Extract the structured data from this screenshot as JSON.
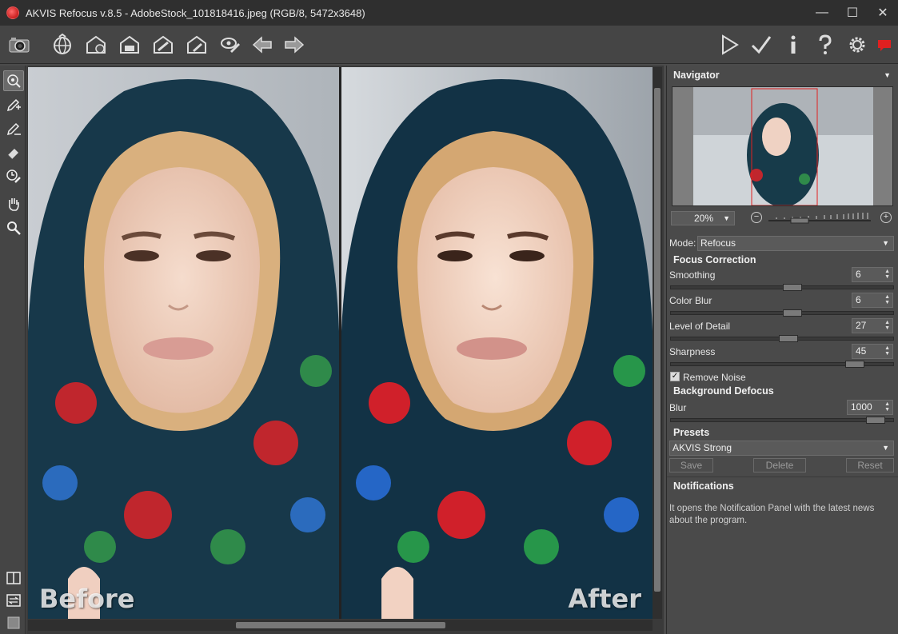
{
  "window": {
    "title": "AKVIS Refocus v.8.5 - AdobeStock_101818416.jpeg (RGB/8, 5472x3648)",
    "minimize": "—",
    "maximize": "☐",
    "close": "✕"
  },
  "toolbar": {
    "left_icons": [
      "camera-icon",
      "open-web-icon",
      "save-icon",
      "print-icon",
      "share-icon",
      "export-icon",
      "batch-icon",
      "undo-arrow-icon",
      "redo-arrow-icon"
    ],
    "right_icons": [
      "run-icon",
      "apply-icon",
      "info-icon",
      "help-icon",
      "settings-icon",
      "news-icon"
    ]
  },
  "tools": [
    "refocus-brush-icon",
    "focus-area-pencil-icon",
    "background-pencil-icon",
    "eraser-icon",
    "history-brush-icon",
    "hand-icon",
    "zoom-icon"
  ],
  "view": {
    "before_label": "Before",
    "after_label": "After"
  },
  "navigator": {
    "title": "Navigator",
    "zoom": "20%",
    "minus": "−",
    "plus": "+"
  },
  "mode": {
    "label": "Mode:",
    "value": "Refocus"
  },
  "focus_correction": {
    "title": "Focus Correction",
    "params": [
      {
        "label": "Smoothing",
        "value": "6",
        "fraction": 0.55
      },
      {
        "label": "Color Blur",
        "value": "6",
        "fraction": 0.55
      },
      {
        "label": "Level of Detail",
        "value": "27",
        "fraction": 0.53
      },
      {
        "label": "Sharpness",
        "value": "45",
        "fraction": 0.86
      }
    ],
    "remove_noise_label": "Remove Noise",
    "remove_noise_checked": true
  },
  "background_defocus": {
    "title": "Background Defocus",
    "blur_label": "Blur",
    "blur_value": "1000",
    "blur_fraction": 0.96
  },
  "presets": {
    "title": "Presets",
    "selected": "AKVIS Strong",
    "save": "Save",
    "delete": "Delete",
    "reset": "Reset"
  },
  "notifications": {
    "title": "Notifications",
    "text": "It opens the Notification Panel with the latest news about the program."
  },
  "colors": {
    "background": "#4b4b4b",
    "panel": "#4a4a4a",
    "accent_red": "#e02020"
  }
}
